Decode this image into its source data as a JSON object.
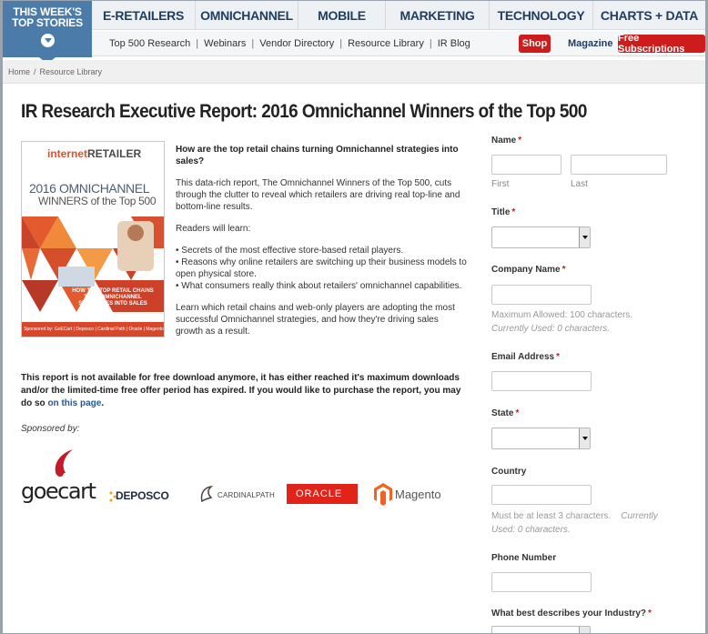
{
  "header": {
    "top_stories_line1": "THIS WEEK'S",
    "top_stories_line2": "TOP STORIES",
    "nav": [
      "E-RETAILERS",
      "OMNICHANNEL",
      "MOBILE",
      "MARKETING",
      "TECHNOLOGY",
      "CHARTS + DATA"
    ],
    "subnav": [
      "Top 500 Research",
      "Webinars",
      "Vendor Directory",
      "Resource Library",
      "IR Blog"
    ],
    "shop": "Shop",
    "magazine": "Magazine",
    "free_subs": "Free Subscriptions"
  },
  "breadcrumb": {
    "home": "Home",
    "sep": "/",
    "current": "Resource Library"
  },
  "title": "IR Research Executive Report: 2016 Omnichannel Winners of the Top 500",
  "cover": {
    "logo_a": "internet",
    "logo_b": "RETAILER",
    "year": "2016 OMNICHANNEL",
    "winners": "WINNERS of the Top 500",
    "how": "HOW THE TOP RETAIL CHAINS TURN OMNICHANNEL STRATEGIES INTO SALES",
    "footer": "Sponsored by: GoECart | Deposco | Cardinal Path | Oracle | Magento"
  },
  "intro": {
    "question": "How are the top retail chains turning Omnichannel strategies into sales?",
    "para1": "This data-rich report, The Omnichannel Winners of the Top 500, cuts through the clutter to reveal which retailers are driving real top-line and bottom-line results.",
    "readers": "Readers will learn:",
    "bullets": [
      "• Secrets of the most effective store-based retail players.",
      "• Reasons why online retailers are switching up their business models to open physical store.",
      "• What consumers really think about retailers' omnichannel capabilities."
    ],
    "para2": "Learn which retail chains and web-only players are adopting the most successful Omnichannel strategies, and how they're driving sales growth as a result."
  },
  "notice": {
    "text": "This report is not available for free download anymore, it has either reached it's maximum downloads and/or the limited-time free offer period has expired. If you would like to purchase the report, you may do so ",
    "link": "on this page",
    "end": "."
  },
  "sponsored_label": "Sponsored by:",
  "sponsors": [
    "goecart",
    "DEPOSCO",
    "CARDINALPATH",
    "ORACLE",
    "Magento"
  ],
  "form": {
    "name_label": "Name",
    "first": "First",
    "last": "Last",
    "title_label": "Title",
    "company_label": "Company Name",
    "company_hint1": "Maximum Allowed: 100 characters.",
    "company_hint2": "Currently Used: 0 characters.",
    "email_label": "Email Address",
    "state_label": "State",
    "country_label": "Country",
    "country_hint1": "Must be at least 3 characters.",
    "country_hint1b": "Currently",
    "country_hint2": "Used: 0 characters.",
    "phone_label": "Phone Number",
    "industry_label": "What best describes your Industry?",
    "required_mark": "*"
  },
  "colors": {
    "accent_red": "#cc1c1c",
    "nav_blue": "#1f3e63",
    "stories_blue": "#4b7ba8"
  }
}
